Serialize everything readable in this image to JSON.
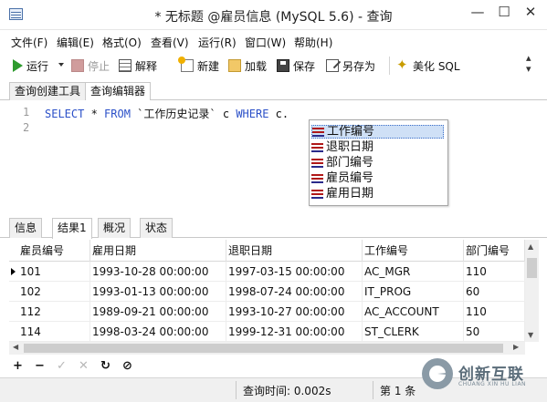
{
  "window": {
    "title": "* 无标题 @雇员信息 (MySQL 5.6) - 查询",
    "minimize": "—",
    "maximize": "☐",
    "close": "✕"
  },
  "menu": [
    "文件(F)",
    "编辑(E)",
    "格式(O)",
    "查看(V)",
    "运行(R)",
    "窗口(W)",
    "帮助(H)"
  ],
  "toolbar": {
    "run": "运行",
    "stop": "停止",
    "explain": "解释",
    "new": "新建",
    "load": "加载",
    "save": "保存",
    "save_as": "另存为",
    "beautify": "美化 SQL",
    "overflow": "»"
  },
  "editor_tabs": [
    "查询创建工具",
    "查询编辑器"
  ],
  "editor": {
    "line_numbers": [
      "1",
      "2"
    ],
    "kw_select": "SELECT",
    "star": " * ",
    "kw_from": "FROM",
    "table": " `工作历史记录` c ",
    "kw_where": "WHERE",
    "tail": " c."
  },
  "autocomplete": [
    "工作编号",
    "退职日期",
    "部门编号",
    "雇员编号",
    "雇用日期"
  ],
  "result_tabs": [
    "信息",
    "结果1",
    "概况",
    "状态"
  ],
  "grid": {
    "columns": [
      "雇员编号",
      "雇用日期",
      "退职日期",
      "工作编号",
      "部门编号"
    ],
    "rows": [
      [
        "101",
        "1993-10-28 00:00:00",
        "1997-03-15 00:00:00",
        "AC_MGR",
        "110"
      ],
      [
        "102",
        "1993-01-13 00:00:00",
        "1998-07-24 00:00:00",
        "IT_PROG",
        "60"
      ],
      [
        "112",
        "1989-09-21 00:00:00",
        "1993-10-27 00:00:00",
        "AC_ACCOUNT",
        "110"
      ],
      [
        "114",
        "1998-03-24 00:00:00",
        "1999-12-31 00:00:00",
        "ST_CLERK",
        "50"
      ]
    ]
  },
  "grid_tools": [
    "+",
    "−",
    "✓",
    "✕",
    "↻",
    "⊘"
  ],
  "status": {
    "query_time": "查询时间: 0.002s",
    "record": "第 1 条"
  },
  "watermark": {
    "name": "创新互联",
    "sub": "CHUANG XIN HU LIAN"
  }
}
